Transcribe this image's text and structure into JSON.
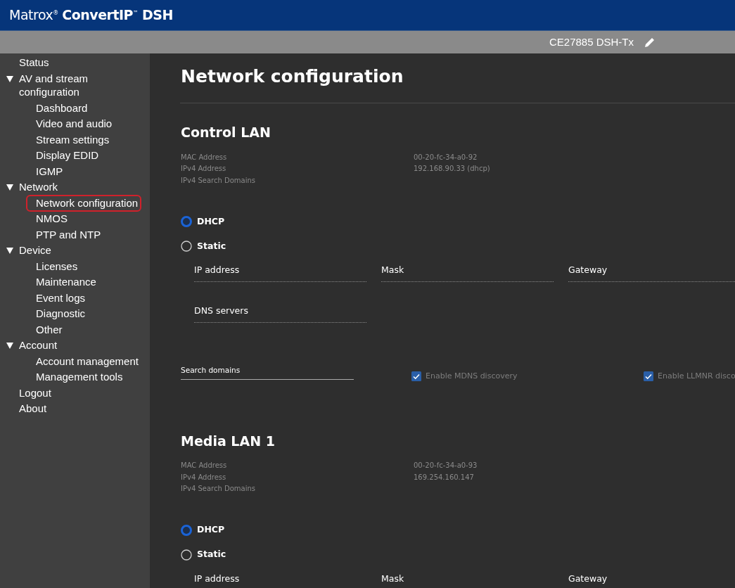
{
  "header": {
    "logo": "Matrox$^{®}$ **ConvertIP**$^{™}$ **DSH**"
  },
  "toolbar": {
    "device_name": "CE27885 DSH-Tx"
  },
  "sidebar": {
    "items": [
      {
        "label": "Status",
        "selected": false
      },
      {
        "label": "AV and stream configuration",
        "selected": false,
        "expanded": true,
        "children": [
          {
            "label": "Dashboard",
            "selected": false
          },
          {
            "label": "Video and audio",
            "selected": false
          },
          {
            "label": "Stream settings",
            "selected": false
          },
          {
            "label": "Display EDID",
            "selected": false
          },
          {
            "label": "IGMP",
            "selected": false
          }
        ]
      },
      {
        "label": "Network",
        "selected": false,
        "expanded": true,
        "children": [
          {
            "label": "Network configuration",
            "selected": true
          },
          {
            "label": "NMOS",
            "selected": false
          },
          {
            "label": "PTP and NTP",
            "selected": false
          }
        ]
      },
      {
        "label": "Device",
        "selected": false,
        "expanded": true,
        "children": [
          {
            "label": "Licenses",
            "selected": false
          },
          {
            "label": "Maintenance",
            "selected": false
          },
          {
            "label": "Event logs",
            "selected": false
          },
          {
            "label": "Diagnostic",
            "selected": false
          },
          {
            "label": "Other",
            "selected": false
          }
        ]
      },
      {
        "label": "Account",
        "selected": false,
        "expanded": true,
        "children": [
          {
            "label": "Account management",
            "selected": false
          },
          {
            "label": "Management tools",
            "selected": false
          }
        ]
      },
      {
        "label": "Logout",
        "selected": false
      },
      {
        "label": "About",
        "selected": false
      }
    ]
  },
  "page": {
    "title": "Network configuration",
    "sections": [
      {
        "title": "Control LAN",
        "info": [
          {
            "label": "MAC Address",
            "value": "00-20-fc-34-a0-92"
          },
          {
            "label": "IPv4 Address",
            "value": "192.168.90.33 (dhcp)"
          },
          {
            "label": "IPv4 Search Domains"
          }
        ],
        "modes": [
          {
            "label": "DHCP",
            "selected": true
          },
          {
            "label": "Static",
            "selected": false
          }
        ],
        "static_fields": [
          "IP address",
          "Mask",
          "Gateway",
          "DNS servers"
        ],
        "search_domains": {
          "label": "Search domains"
        },
        "options": [
          {
            "label": "Enable MDNS discovery",
            "checked": true,
            "disabled": true
          },
          {
            "label": "Enable LLMNR disco",
            "checked": true,
            "disabled": true
          }
        ]
      },
      {
        "title": "Media LAN 1",
        "info": [
          {
            "label": "MAC Address",
            "value": "00-20-fc-34-a0-93"
          },
          {
            "label": "IPv4 Address",
            "value": "169.254.160.147"
          },
          {
            "label": "IPv4 Search Domains"
          }
        ],
        "modes": [
          {
            "label": "DHCP",
            "selected": true
          },
          {
            "label": "Static",
            "selected": false
          }
        ],
        "static_fields": [
          "IP address",
          "Mask",
          "Gateway"
        ]
      }
    ]
  }
}
